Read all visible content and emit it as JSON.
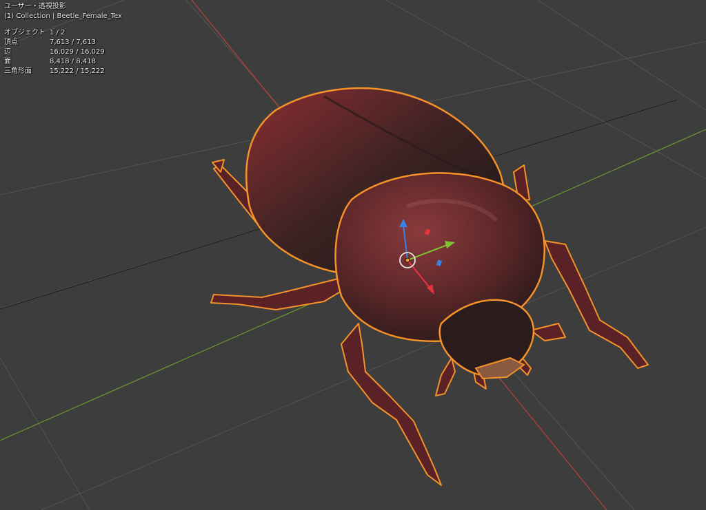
{
  "viewport": {
    "view_mode": "ユーザー・透視投影",
    "collection_line": "(1) Collection | Beetle_Female_Tex"
  },
  "stats": [
    {
      "label": "オブジェクト",
      "value": "1 / 2"
    },
    {
      "label": "頂点",
      "value": "7,613 / 7,613"
    },
    {
      "label": "辺",
      "value": "16,029 / 16,029"
    },
    {
      "label": "面",
      "value": "8,418 / 8,418"
    },
    {
      "label": "三角形面",
      "value": "15,222 / 15,222"
    }
  ],
  "colors": {
    "background": "#3d3d3d",
    "grid": "#545454",
    "axis_x": "#b8403f",
    "axis_y": "#6a9a2e",
    "selection_outline": "#f5922a",
    "gizmo_x": "#e8343f",
    "gizmo_y": "#7ec433",
    "gizmo_z": "#3b82e6"
  },
  "icons": [
    "object-origin-icon",
    "transform-gizmo-icon"
  ]
}
